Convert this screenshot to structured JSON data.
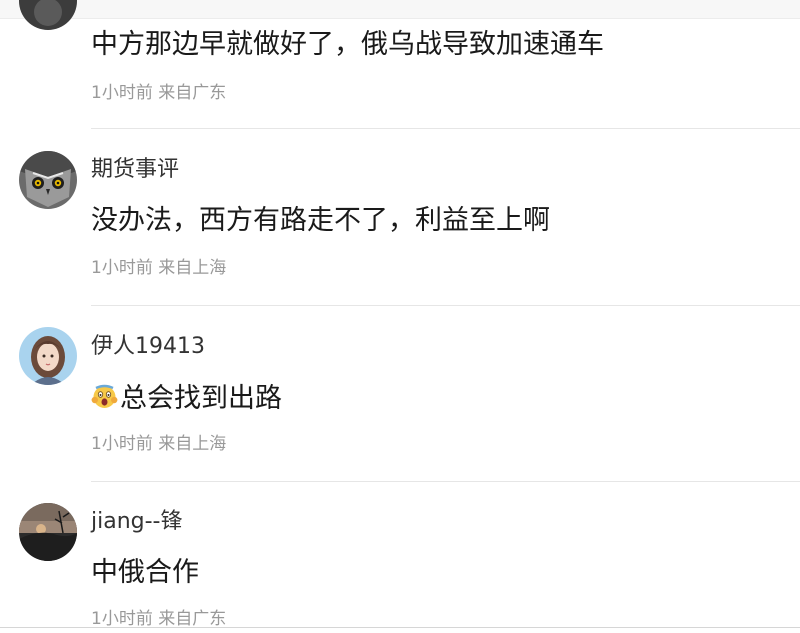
{
  "comments": [
    {
      "content": "中方那边早就做好了，俄乌战导致加速通车",
      "meta": "1小时前 来自广东"
    },
    {
      "username": "期货事评",
      "content": "没办法，西方有路走不了，利益至上啊",
      "meta": "1小时前 来自上海",
      "avatar_icon": "owl-avatar-icon"
    },
    {
      "username": "伊人19413",
      "emoji_icon": "screaming-face-emoji-icon",
      "content": "总会找到出路",
      "meta": "1小时前 来自上海",
      "avatar_icon": "girl-avatar-icon"
    },
    {
      "username": "jiang--锋",
      "content": "中俄合作",
      "meta": "1小时前 来自广东",
      "avatar_icon": "sunset-avatar-icon"
    }
  ],
  "colors": {
    "username": "#333333",
    "content": "#1a1a1a",
    "meta": "#999999",
    "divider": "#e6e6e6"
  }
}
